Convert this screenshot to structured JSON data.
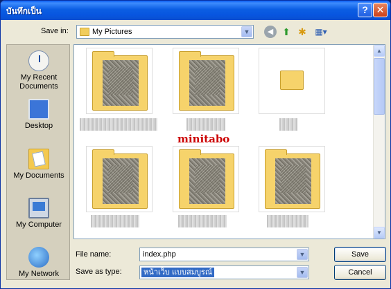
{
  "window": {
    "title": "บันทึกเป็น",
    "help_label": "?",
    "close_label": "✕"
  },
  "toolbar": {
    "save_in_label": "Save in:",
    "save_in_value": "My Pictures",
    "icons": [
      "back-icon",
      "up-folder-icon",
      "new-folder-icon",
      "views-menu-icon"
    ]
  },
  "places": [
    {
      "label": "My Recent Documents",
      "icon": "recent-documents-icon"
    },
    {
      "label": "Desktop",
      "icon": "desktop-icon"
    },
    {
      "label": "My Documents",
      "icon": "my-documents-icon"
    },
    {
      "label": "My Computer",
      "icon": "my-computer-icon"
    },
    {
      "label": "My Network",
      "icon": "my-network-icon"
    }
  ],
  "watermark": "minitabo",
  "form": {
    "file_name_label": "File name:",
    "file_name_value": "index.php",
    "save_as_type_label": "Save as type:",
    "save_as_type_value": "หน้าเว็บ แบบสมบูรณ์"
  },
  "buttons": {
    "save": "Save",
    "cancel": "Cancel"
  },
  "colors": {
    "titlebar": "#0a5ef5",
    "dialog_bg": "#ece9d8",
    "selection": "#316ac5",
    "watermark": "#cc0000"
  }
}
